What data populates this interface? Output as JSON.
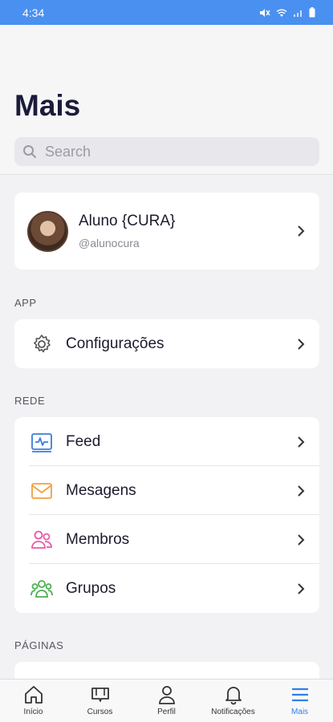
{
  "status_bar": {
    "time": "4:34",
    "icons": [
      "mute-icon",
      "wifi-icon",
      "signal-icon",
      "battery-icon"
    ]
  },
  "header": {
    "title": "Mais"
  },
  "search": {
    "placeholder": "Search"
  },
  "profile": {
    "name": "Aluno {CURA}",
    "handle": "@alunocura"
  },
  "sections": {
    "app": {
      "label": "APP",
      "items": [
        {
          "label": "Configurações",
          "icon": "gear-icon"
        }
      ]
    },
    "rede": {
      "label": "REDE",
      "items": [
        {
          "label": "Feed",
          "icon": "activity-icon",
          "color": "#3b7dd8"
        },
        {
          "label": "Mesagens",
          "icon": "envelope-icon",
          "color": "#f0a040"
        },
        {
          "label": "Membros",
          "icon": "members-icon",
          "color": "#e75ba6"
        },
        {
          "label": "Grupos",
          "icon": "groups-icon",
          "color": "#4caf50"
        }
      ]
    },
    "paginas": {
      "label": "PÁGINAS"
    }
  },
  "tabbar": {
    "items": [
      {
        "label": "Início",
        "icon": "home-icon"
      },
      {
        "label": "Cursos",
        "icon": "courses-icon"
      },
      {
        "label": "Perfil",
        "icon": "profile-icon"
      },
      {
        "label": "Notificações",
        "icon": "bell-icon"
      },
      {
        "label": "Mais",
        "icon": "menu-icon",
        "active": true
      }
    ]
  },
  "colors": {
    "accent": "#2f80ed",
    "status_bar": "#4a90f0",
    "title": "#1b1b3a"
  }
}
